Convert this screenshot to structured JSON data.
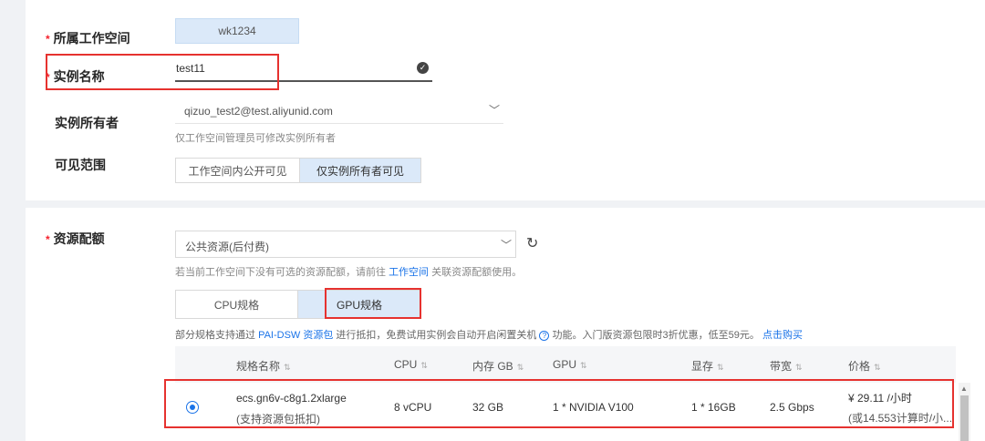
{
  "form": {
    "workspace": {
      "label": "所属工作空间",
      "value": "wk1234"
    },
    "instance_name": {
      "label": "实例名称",
      "value": "test11"
    },
    "owner": {
      "label": "实例所有者",
      "value": "qizuo_test2@test.aliyunid.com",
      "hint": "仅工作空间管理员可修改实例所有者"
    },
    "visibility": {
      "label": "可见范围",
      "options": [
        "工作空间内公开可见",
        "仅实例所有者可见"
      ],
      "selected": "仅实例所有者可见"
    }
  },
  "resource": {
    "label": "资源配额",
    "select_value": "公共资源(后付费)",
    "hint_prefix": "若当前工作空间下没有可选的资源配额，请前往",
    "hint_link": "工作空间",
    "hint_suffix": "关联资源配额使用。",
    "spec_tabs": [
      "CPU规格",
      "GPU规格"
    ],
    "selected_tab": "GPU规格",
    "promo_prefix": "部分规格支持通过",
    "promo_link": "PAI-DSW 资源包",
    "promo_middle": "进行抵扣，免费试用实例会自动开启闲置关机",
    "promo_suffix": "功能。入门版资源包限时3折优惠，低至59元。",
    "promo_buy": "点击购买"
  },
  "table": {
    "headers": [
      "规格名称",
      "CPU",
      "内存 GB",
      "GPU",
      "显存",
      "带宽",
      "价格"
    ],
    "row": {
      "name": "ecs.gn6v-c8g1.2xlarge",
      "name_note": "(支持资源包抵扣)",
      "cpu": "8 vCPU",
      "memory": "32 GB",
      "gpu": "1 * NVIDIA V100",
      "vram": "1 * 16GB",
      "bandwidth": "2.5 Gbps",
      "price": "¥ 29.11 /小时",
      "price_note": "(或14.553计算时/小..."
    }
  },
  "colors": {
    "accent": "#1a73e8",
    "highlight": "#e6322f",
    "selected_bg": "#dbe9f9"
  }
}
